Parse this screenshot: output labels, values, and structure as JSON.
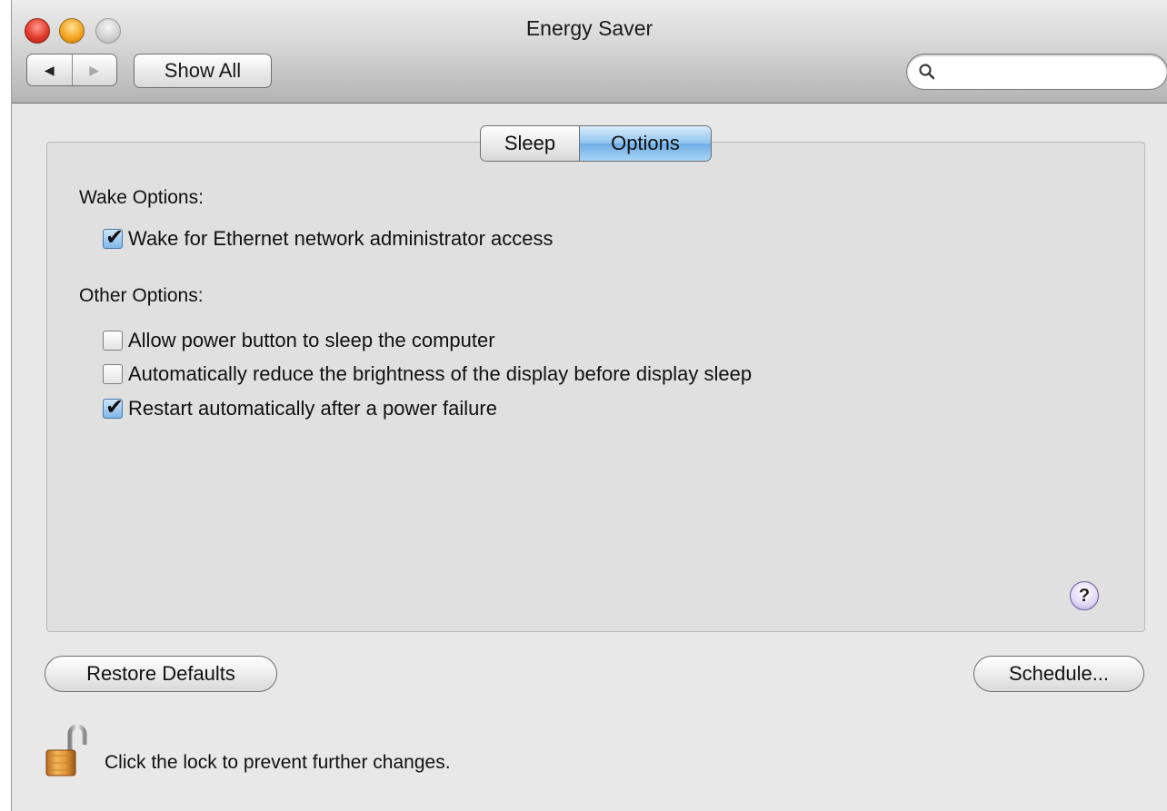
{
  "window": {
    "title": "Energy Saver"
  },
  "toolbar": {
    "back_label": "◀",
    "forward_label": "▶",
    "show_all_label": "Show All",
    "search_placeholder": "",
    "search_value": ""
  },
  "tabs": [
    {
      "label": "Sleep",
      "selected": false
    },
    {
      "label": "Options",
      "selected": true
    }
  ],
  "wake_options": {
    "heading": "Wake Options:",
    "items": [
      {
        "label": "Wake for Ethernet network administrator access",
        "checked": true
      }
    ]
  },
  "other_options": {
    "heading": "Other Options:",
    "items": [
      {
        "label": "Allow power button to sleep the computer",
        "checked": false
      },
      {
        "label": "Automatically reduce the brightness of the display before display sleep",
        "checked": false
      },
      {
        "label": "Restart automatically after a power failure",
        "checked": true
      }
    ]
  },
  "help": {
    "label": "?"
  },
  "footer": {
    "restore_defaults_label": "Restore Defaults",
    "schedule_label": "Schedule...",
    "lock_message": "Click the lock to prevent further changes."
  },
  "colors": {
    "selected_tab": "#8fc4ef",
    "checkbox_checked": "#7fb7e8",
    "close": "#e23b2c",
    "minimize": "#f5a623",
    "zoom": "#cfcfcf"
  }
}
